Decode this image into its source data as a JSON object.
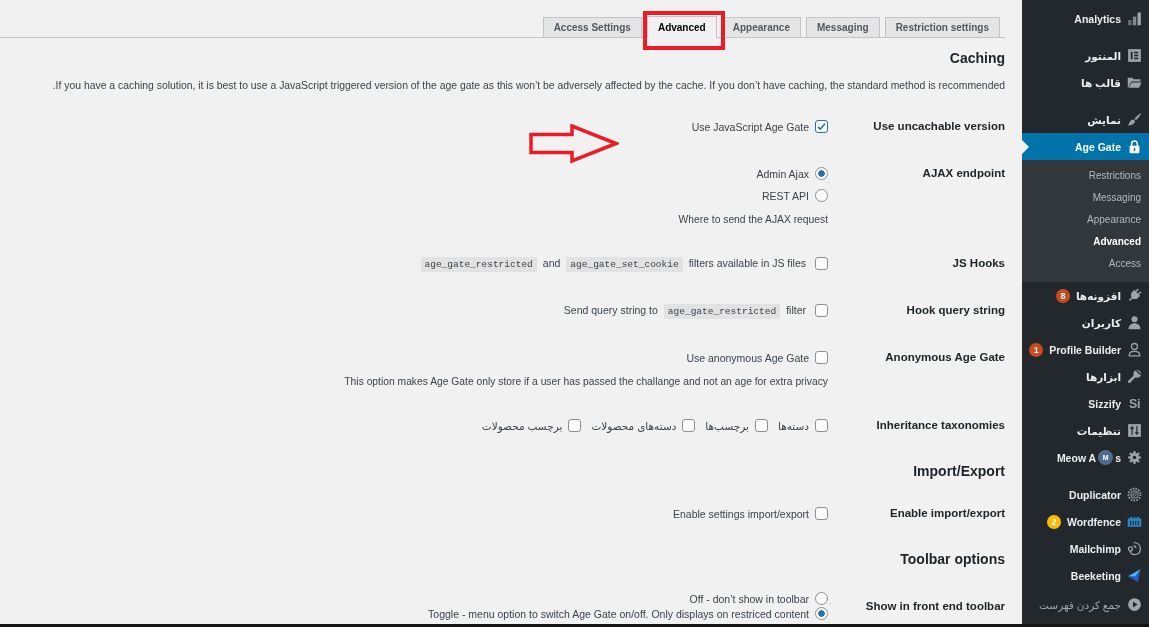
{
  "tabs": [
    {
      "label": "Access Settings",
      "selected": false
    },
    {
      "label": "Advanced",
      "selected": true
    },
    {
      "label": "Appearance",
      "selected": false
    },
    {
      "label": "Messaging",
      "selected": false
    },
    {
      "label": "Restriction settings",
      "selected": false
    }
  ],
  "sections": [
    {
      "heading": "Caching",
      "description": "If you have a caching solution, it is best to use a JavaScript triggered version of the age gate as this won’t be adversely affected by the cache. If you don’t have caching, the standard method is recommended.",
      "fields": [
        {
          "label": "Use uncachable version",
          "kind": "checkbox",
          "options": [
            {
              "text": "Use JavaScript Age Gate",
              "checked": true
            }
          ]
        },
        {
          "label": "AJAX endpoint",
          "kind": "radio",
          "options": [
            {
              "text": "Admin Ajax",
              "selected": true
            },
            {
              "text": "REST API",
              "selected": false
            }
          ],
          "description": "Where to send the AJAX request"
        },
        {
          "label": "JS Hooks",
          "kind": "checkbox",
          "options": [
            {
              "segments": [
                {
                  "kind": "code",
                  "text": "age_gate_restricted"
                },
                {
                  "kind": "text",
                  "text": "and"
                },
                {
                  "kind": "code",
                  "text": "age_gate_set_cookie"
                },
                {
                  "kind": "text",
                  "text": "filters available in JS files"
                }
              ],
              "checked": false
            }
          ]
        },
        {
          "label": "Hook query string",
          "kind": "checkbox",
          "options": [
            {
              "segments": [
                {
                  "kind": "text",
                  "text": "Send query string to"
                },
                {
                  "kind": "code",
                  "text": "age_gate_restricted"
                },
                {
                  "kind": "text",
                  "text": "filter"
                }
              ],
              "checked": false
            }
          ]
        },
        {
          "label": "Anonymous Age Gate",
          "kind": "checkbox",
          "options": [
            {
              "text": "Use anonymous Age Gate",
              "checked": false
            }
          ],
          "description": "This option makes Age Gate only store if a user has passed the challange and not an age for extra privacy"
        },
        {
          "label": "Inheritance taxonomies",
          "kind": "checkbox-inline",
          "options": [
            {
              "text": "دسته‌ها",
              "checked": false
            },
            {
              "text": "برچسب‌ها",
              "checked": false
            },
            {
              "text": "دسته‌های محصولات",
              "checked": false
            },
            {
              "text": "برچسب محصولات",
              "checked": false
            }
          ]
        }
      ]
    },
    {
      "heading": "Import/Export",
      "fields": [
        {
          "label": "Enable import/export",
          "kind": "checkbox",
          "options": [
            {
              "text": "Enable settings import/export",
              "checked": false
            }
          ]
        }
      ]
    },
    {
      "heading": "Toolbar options",
      "fields": [
        {
          "label": "Show in front end toolbar",
          "kind": "radio",
          "options": [
            {
              "text": "Off - don’t show in toolbar",
              "selected": false
            },
            {
              "text": "Toggle - menu option to switch Age Gate on/off. Only displays on restriced content",
              "selected": true
            }
          ]
        }
      ]
    }
  ],
  "sidebar": {
    "groups": [
      {
        "items": [
          {
            "label": "Analytics",
            "selected": false
          }
        ]
      },
      {
        "items": [
          {
            "label": "المنتور",
            "selected": false
          },
          {
            "label": "قالب ها",
            "selected": false
          }
        ]
      },
      {
        "items": [
          {
            "label": "نمایش",
            "selected": false
          },
          {
            "label": "Age Gate",
            "selected": true,
            "children": [
              {
                "label": "Restrictions",
                "selected": false
              },
              {
                "label": "Messaging",
                "selected": false
              },
              {
                "label": "Appearance",
                "selected": false
              },
              {
                "label": "Advanced",
                "selected": true
              },
              {
                "label": "Access",
                "selected": false
              }
            ]
          },
          {
            "label": "افزونه‌ها",
            "selected": false,
            "badge": {
              "text": "8",
              "color": "#ca4a1f"
            }
          },
          {
            "label": "کاربران",
            "selected": false
          },
          {
            "label": "Profile Builder",
            "selected": false,
            "badge": {
              "text": "1",
              "color": "#ca4a1f"
            }
          },
          {
            "label": "ابزارها",
            "selected": false
          },
          {
            "label": "Sizzify",
            "selected": false,
            "icon_text": "Si"
          },
          {
            "label": "تنظیمات",
            "selected": false
          },
          {
            "label": "Meow A",
            "selected": false,
            "overlay": {
              "text": "M"
            },
            "label_end": "s"
          }
        ]
      },
      {
        "items": [
          {
            "label": "Duplicator",
            "selected": false
          },
          {
            "label": "Wordfence",
            "selected": false,
            "badge": {
              "text": "2",
              "color": "#ffb900"
            }
          },
          {
            "label": "Mailchimp",
            "selected": false
          },
          {
            "label": "Beeketing",
            "selected": false
          }
        ]
      }
    ],
    "collapse": {
      "label": "جمع کردن فهرست"
    }
  }
}
